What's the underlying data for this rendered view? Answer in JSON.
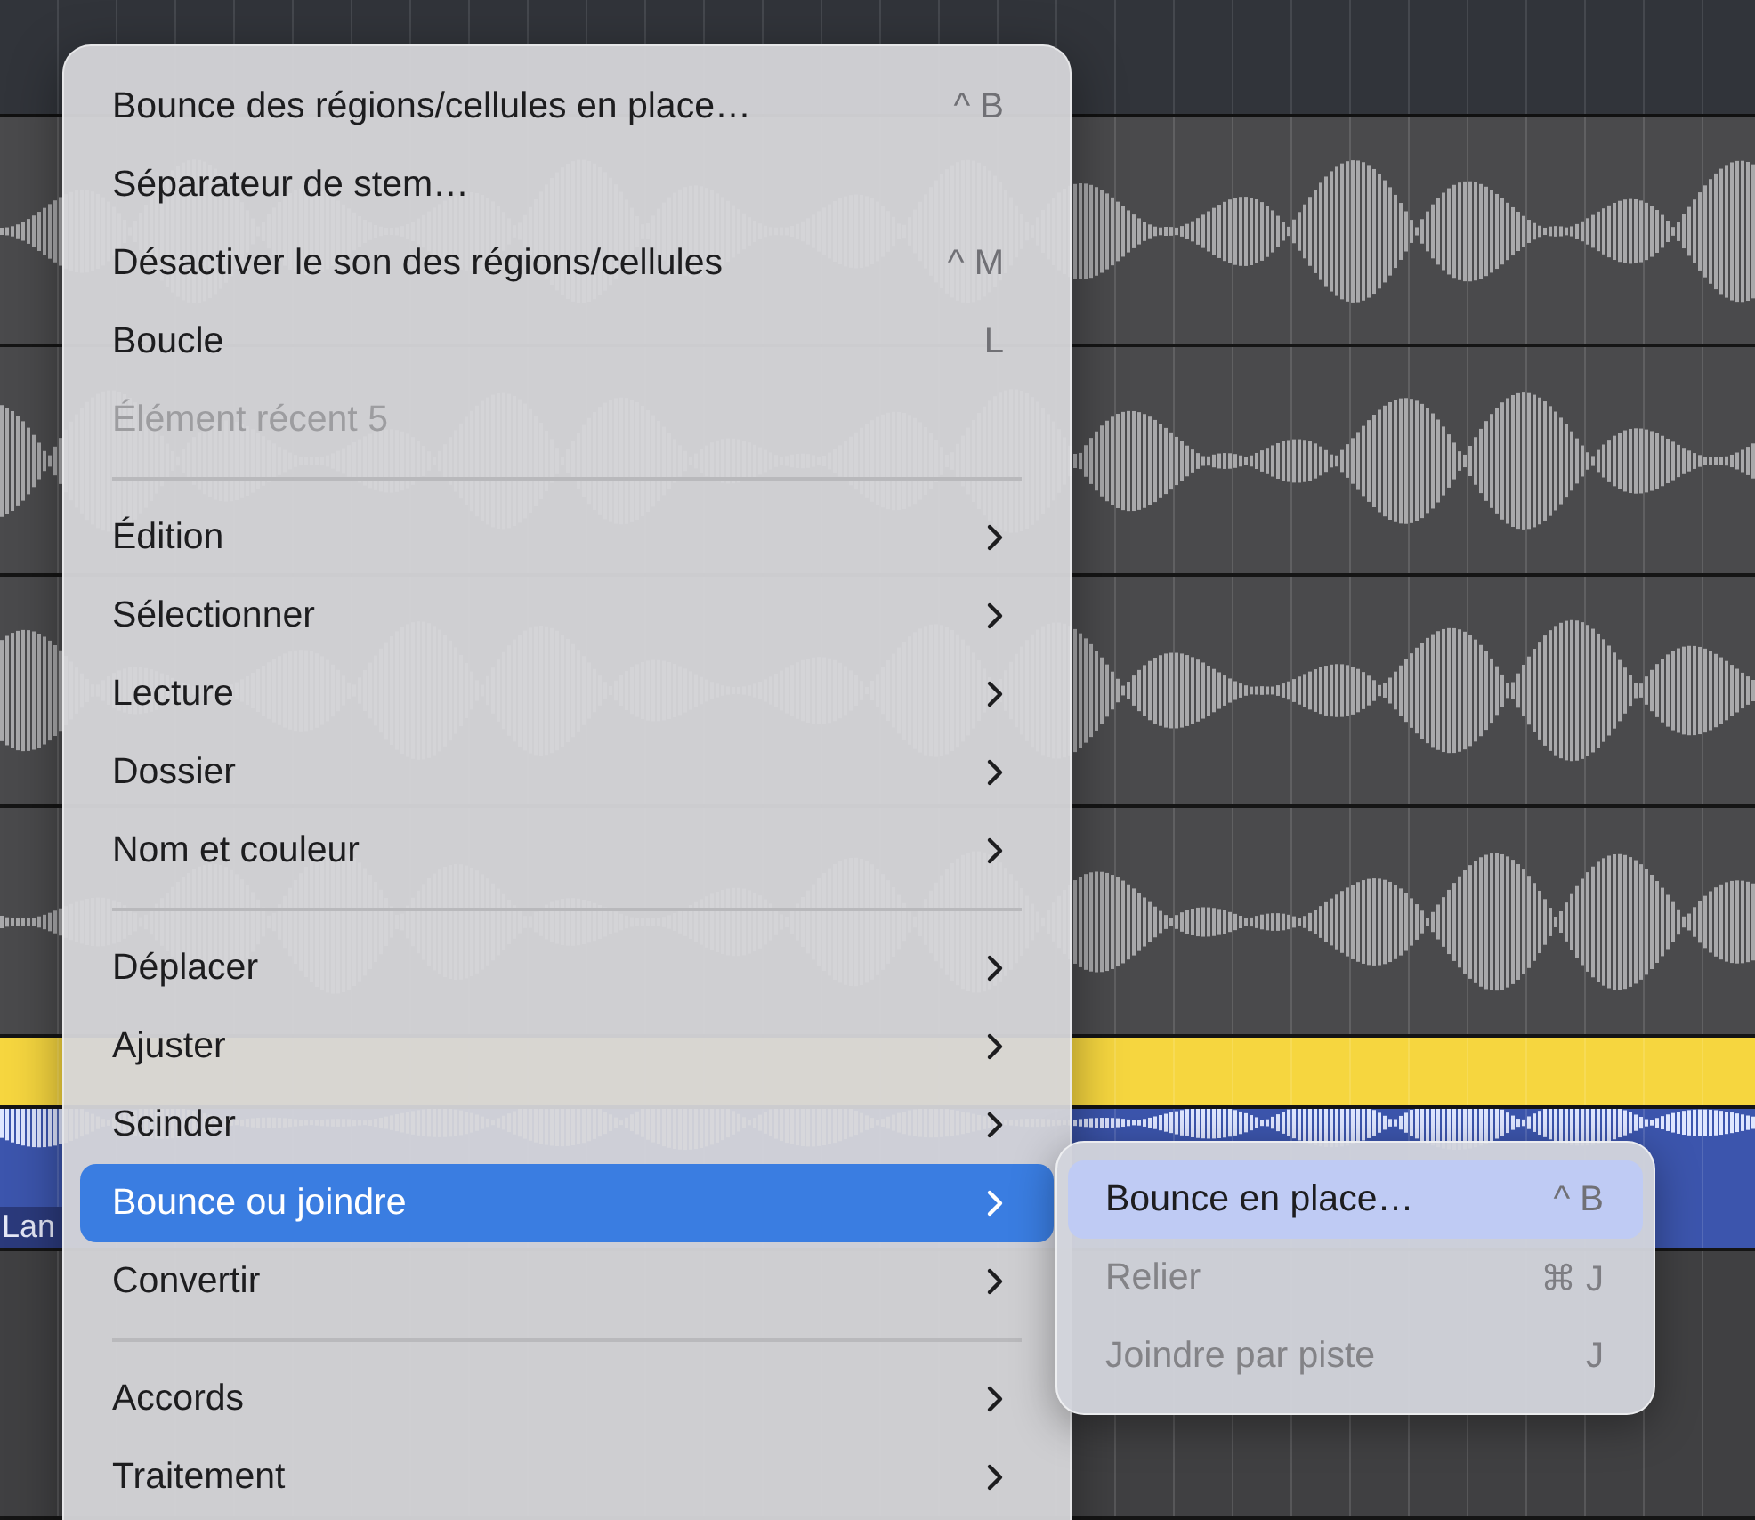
{
  "tracks": [
    {
      "color": "#4a4a4c",
      "waveform": true
    },
    {
      "color": "#4a4a4c",
      "waveform": true
    },
    {
      "color": "#4a4a4c",
      "waveform": true
    },
    {
      "color": "#4a4a4c",
      "waveform": true
    },
    {
      "color": "#f6d63f",
      "waveform": false
    },
    {
      "color": "#3c55ad",
      "waveform": true,
      "label": "Lan"
    },
    {
      "color": "#404042",
      "waveform": false
    }
  ],
  "menu": {
    "items": [
      {
        "kind": "item",
        "label": "Bounce des régions/cellules en place…",
        "shortcut": "^ B",
        "submenu": false,
        "disabled": false,
        "selected": false
      },
      {
        "kind": "item",
        "label": "Séparateur de stem…",
        "submenu": false,
        "disabled": false,
        "selected": false
      },
      {
        "kind": "item",
        "label": "Désactiver le son des régions/cellules",
        "shortcut": "^ M",
        "submenu": false,
        "disabled": false,
        "selected": false
      },
      {
        "kind": "item",
        "label": "Boucle",
        "shortcut": "L",
        "submenu": false,
        "disabled": false,
        "selected": false
      },
      {
        "kind": "item",
        "label": "Élément récent 5",
        "submenu": false,
        "disabled": true,
        "selected": false
      },
      {
        "kind": "separator"
      },
      {
        "kind": "item",
        "label": "Édition",
        "submenu": true,
        "disabled": false,
        "selected": false
      },
      {
        "kind": "item",
        "label": "Sélectionner",
        "submenu": true,
        "disabled": false,
        "selected": false
      },
      {
        "kind": "item",
        "label": "Lecture",
        "submenu": true,
        "disabled": false,
        "selected": false
      },
      {
        "kind": "item",
        "label": "Dossier",
        "submenu": true,
        "disabled": false,
        "selected": false
      },
      {
        "kind": "item",
        "label": "Nom et couleur",
        "submenu": true,
        "disabled": false,
        "selected": false
      },
      {
        "kind": "separator"
      },
      {
        "kind": "item",
        "label": "Déplacer",
        "submenu": true,
        "disabled": false,
        "selected": false
      },
      {
        "kind": "item",
        "label": "Ajuster",
        "submenu": true,
        "disabled": false,
        "selected": false
      },
      {
        "kind": "item",
        "label": "Scinder",
        "submenu": true,
        "disabled": false,
        "selected": false
      },
      {
        "kind": "item",
        "label": "Bounce ou joindre",
        "submenu": true,
        "disabled": false,
        "selected": true
      },
      {
        "kind": "item",
        "label": "Convertir",
        "submenu": true,
        "disabled": false,
        "selected": false
      },
      {
        "kind": "separator"
      },
      {
        "kind": "item",
        "label": "Accords",
        "submenu": true,
        "disabled": false,
        "selected": false
      },
      {
        "kind": "item",
        "label": "Traitement",
        "submenu": true,
        "disabled": false,
        "selected": false
      }
    ]
  },
  "submenu": {
    "items": [
      {
        "label": "Bounce en place…",
        "shortcut": "^ B",
        "disabled": false,
        "selected": true
      },
      {
        "label": "Relier",
        "shortcut": "⌘ J",
        "disabled": true,
        "selected": false
      },
      {
        "label": "Joindre par piste",
        "shortcut": "J",
        "disabled": true,
        "selected": false
      }
    ]
  }
}
